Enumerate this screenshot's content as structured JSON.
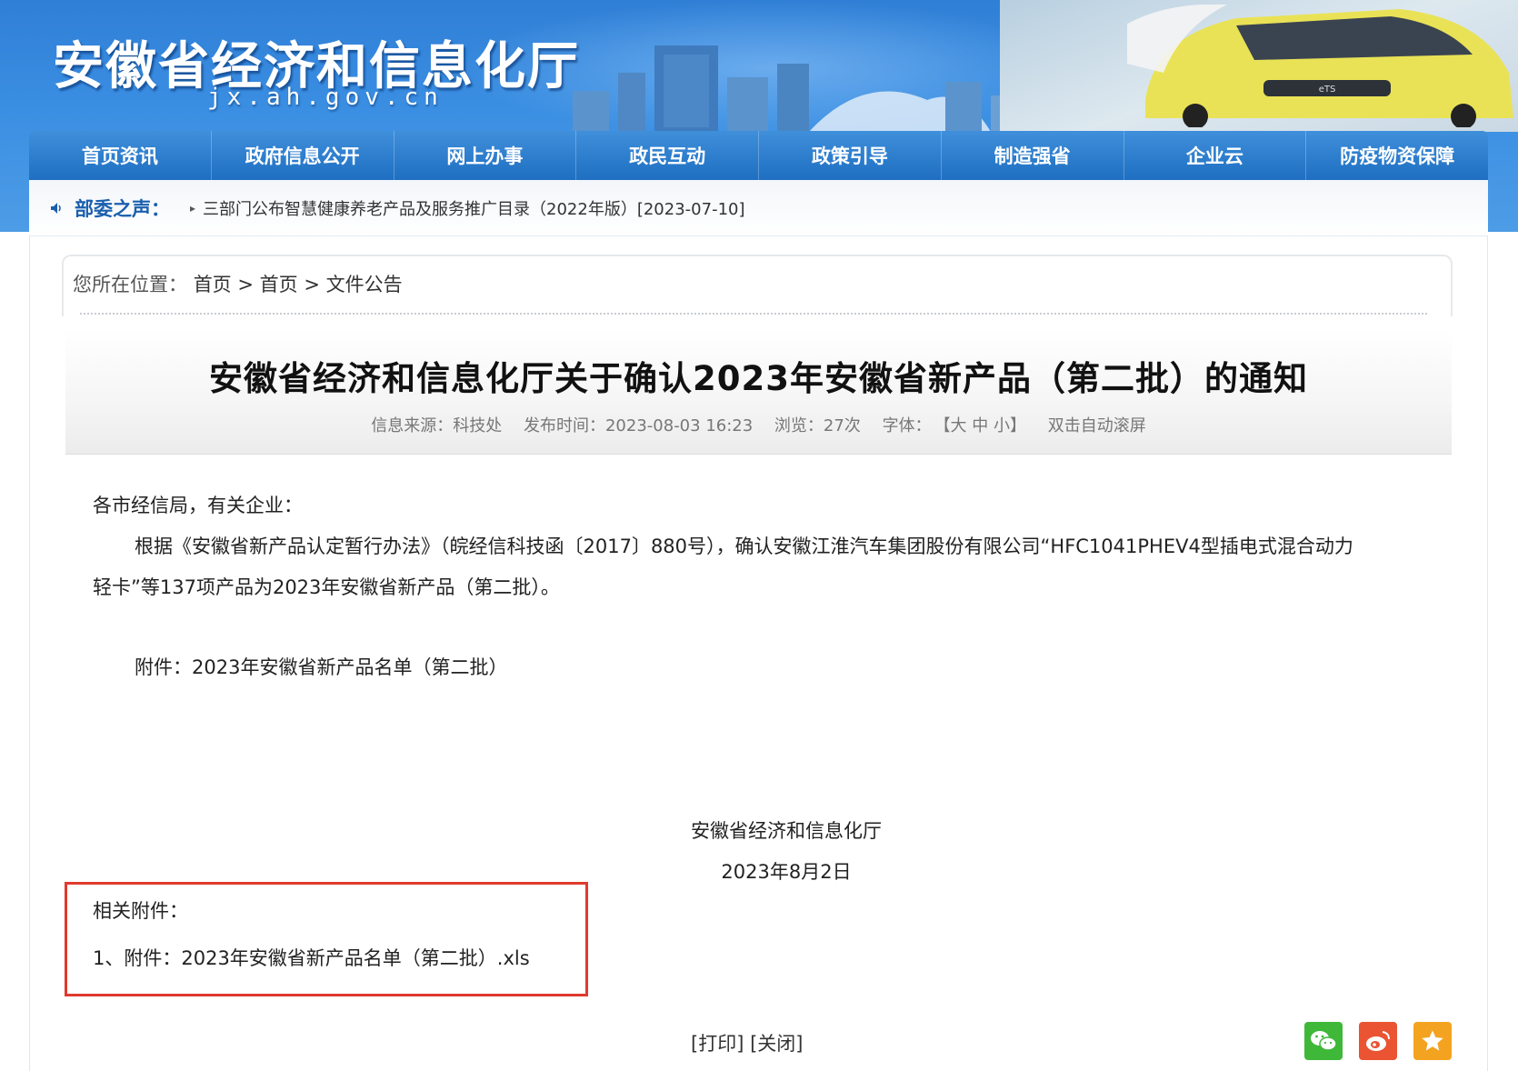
{
  "header": {
    "site_title": "安徽省经济和信息化厅",
    "site_domain": "jx.ah.gov.cn"
  },
  "nav": {
    "items": [
      {
        "label": "首页资讯"
      },
      {
        "label": "政府信息公开"
      },
      {
        "label": "网上办事"
      },
      {
        "label": "政民互动"
      },
      {
        "label": "政策引导"
      },
      {
        "label": "制造强省"
      },
      {
        "label": "企业云"
      },
      {
        "label": "防疫物资保障"
      }
    ]
  },
  "voice": {
    "label": "部委之声：",
    "news": "三部门公布智慧健康养老产品及服务推广目录（2022年版）[2023-07-10]"
  },
  "breadcrumb": {
    "prefix": "您所在位置：",
    "items": [
      "首页",
      "首页",
      "文件公告"
    ],
    "sep": ">"
  },
  "article": {
    "title": "安徽省经济和信息化厅关于确认2023年安徽省新产品（第二批）的通知",
    "meta": {
      "source": "信息来源：科技处",
      "published": "发布时间：2023-08-03 16:23",
      "views": "浏览：27次",
      "font_label": "字体：",
      "font_sizes": "【大 中 小】",
      "autoscroll": "双击自动滚屏"
    },
    "salutation": "各市经信局，有关企业：",
    "paragraph_1a": "根据《安徽省新产品认定暂行办法》（皖经信科技函〔2017〕880号），确认安徽江淮汽车集团股份有限公司“HFC1041PHEV4型插电式混合动力",
    "paragraph_1b": "轻卡”等137项产品为2023年安徽省新产品（第二批）。",
    "attachment_note": "附件：2023年安徽省新产品名单（第二批）",
    "signature_org": "安徽省经济和信息化厅",
    "signature_date": "2023年8月2日"
  },
  "attachments": {
    "title": "相关附件：",
    "files": [
      "1、附件：2023年安徽省新产品名单（第二批）.xls"
    ]
  },
  "actions": {
    "print": "[打印]",
    "close": "[关闭]"
  },
  "share": {
    "icons": [
      "wechat-icon",
      "weibo-icon",
      "favorite-icon"
    ],
    "colors": {
      "wechat": "#3fb83a",
      "weibo": "#ea5432",
      "favorite": "#f4a320"
    }
  },
  "theme": {
    "nav_blue": "#1f6fc2",
    "banner_blue": "#3a8ee2",
    "highlight_red": "#e03a2e"
  }
}
